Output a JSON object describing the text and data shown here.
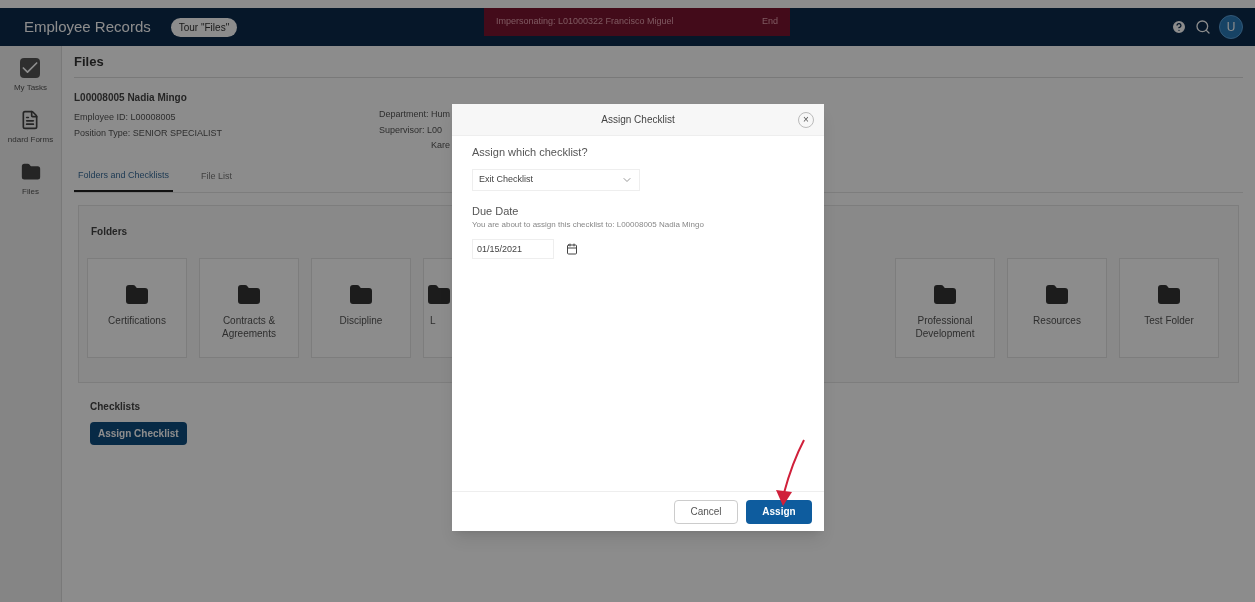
{
  "header": {
    "title": "Employee Records",
    "tour_button": "Tour \"Files\"",
    "impersonation": {
      "text": "Impersonating: L01000322 Francisco Miguel",
      "end": "End"
    },
    "avatar": "U"
  },
  "sidebar": {
    "items": [
      {
        "label": "My Tasks",
        "kind": "tasks"
      },
      {
        "label": "ndard Forms",
        "kind": "forms"
      },
      {
        "label": "Files",
        "kind": "files"
      }
    ]
  },
  "page": {
    "title": "Files",
    "employee": "L00008005 Nadia Mingo",
    "details_left": [
      "Employee ID: L00008005",
      "Position Type: SENIOR SPECIALIST"
    ],
    "details_right": [
      "Department: Hum",
      "Supervisor: L00",
      "Kare"
    ],
    "tabs": [
      {
        "label": "Folders and Checklists",
        "selected": true
      },
      {
        "label": "File List",
        "selected": false
      }
    ],
    "folders_title": "Folders",
    "folders_left": [
      "Certifications",
      "Contracts & Agreements",
      "Discipline",
      "L"
    ],
    "folders_right": [
      "Professional Development",
      "Resources",
      "Test Folder"
    ],
    "checklists_title": "Checklists",
    "assign_button": "Assign Checklist"
  },
  "modal": {
    "title": "Assign Checklist",
    "close": "×",
    "question": "Assign which checklist?",
    "checklist": "Exit Checklist",
    "due_label": "Due Date",
    "due_hint": "You are about to assign this checklist to: L00008005 Nadia Mingo",
    "due_date": "01/15/2021",
    "cancel": "Cancel",
    "assign": "Assign"
  }
}
